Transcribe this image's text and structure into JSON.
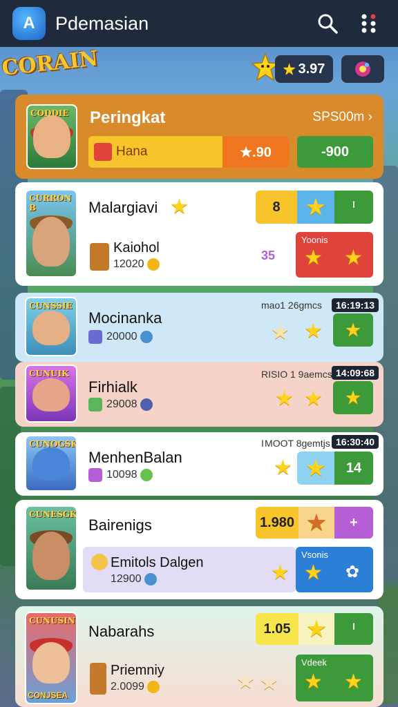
{
  "app": {
    "title": "Pdemasian",
    "logo_glyph": "A"
  },
  "topbar": {
    "search_icon": "search-icon",
    "menu_icon": "dots-grid-icon"
  },
  "background": {
    "game_logo_text": "CORAIN"
  },
  "currency": {
    "value": "3.97"
  },
  "header_card": {
    "thumb_label": "CODDIE",
    "title": "Peringkat",
    "link": "SPS00m ›",
    "bar_name": "Hana",
    "bar_score": "★.90",
    "bar_right": "-900"
  },
  "entries": [
    {
      "thumb_label": "CURRON B",
      "name": "Malargiavi",
      "sub_name": "Kaiohol",
      "sub_score": "12020",
      "seg1": "8",
      "side_label": "Yoonis",
      "sidecount": "35"
    },
    {
      "thumb_label": "CUNSSIE",
      "name": "Mocinanka",
      "score": "20000",
      "meta": "mao1 26gmcs",
      "time": "16:19:13"
    },
    {
      "thumb_label": "CUNUIK",
      "name": "Firhialk",
      "score": "29008",
      "meta": "RISIO 1 9aemcs",
      "time": "14:09:68"
    },
    {
      "thumb_label": "CUNOGSK",
      "name": "MenhenBalan",
      "score": "10098",
      "meta": "I MOOT 8gemtjs",
      "time": "16:30:40",
      "seg": "14"
    },
    {
      "thumb_label": "CUNESGK",
      "name": "Bairenigs",
      "seg1": "1.980",
      "sub_name": "Emitols Dalgen",
      "sub_score": "12900",
      "side_label": "Vsonis"
    },
    {
      "thumb_label": "CUNUSIN",
      "name": "Nabarahs",
      "seg1": "1.05",
      "sub_name": "Priemniy",
      "sub_score": "2.0099",
      "side_label": "Vdeek",
      "logo_text": "CONJSEA"
    }
  ],
  "colors": {
    "appbar": "#1f2a3c",
    "orange_card": "#d98a2b",
    "yellow": "#f7c52b",
    "green": "#3c9a3a",
    "red": "#e0433a",
    "blue": "#2b7fd6",
    "purple": "#b45fd6",
    "light_blue": "#cfe8f7",
    "peach": "#f6d3c8",
    "lavender": "#e2dcf7",
    "mint": "#d7f1e4"
  }
}
